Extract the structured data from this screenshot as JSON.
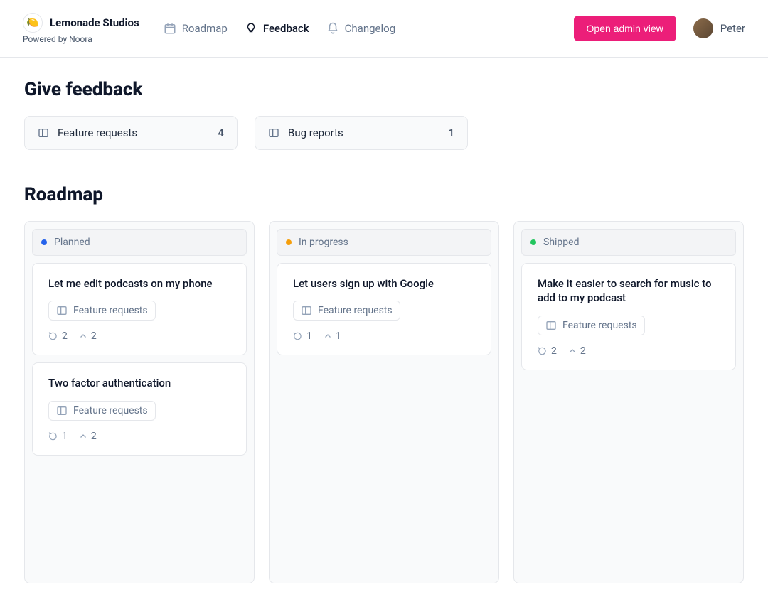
{
  "brand": {
    "name": "Lemonade Studios",
    "powered_by": "Powered by Noora",
    "logo_emoji": "🍋"
  },
  "nav": {
    "roadmap": "Roadmap",
    "feedback": "Feedback",
    "changelog": "Changelog"
  },
  "header": {
    "admin_button": "Open admin view",
    "user_name": "Peter"
  },
  "sections": {
    "give_feedback": "Give feedback",
    "roadmap": "Roadmap"
  },
  "feedback_boards": [
    {
      "label": "Feature requests",
      "count": "4"
    },
    {
      "label": "Bug reports",
      "count": "1"
    }
  ],
  "columns": [
    {
      "title": "Planned",
      "dot": "blue",
      "cards": [
        {
          "title": "Let me edit podcasts on my phone",
          "tag": "Feature requests",
          "comments": "2",
          "votes": "2"
        },
        {
          "title": "Two factor authentication",
          "tag": "Feature requests",
          "comments": "1",
          "votes": "2"
        }
      ]
    },
    {
      "title": "In progress",
      "dot": "amber",
      "cards": [
        {
          "title": "Let users sign up with Google",
          "tag": "Feature requests",
          "comments": "1",
          "votes": "1"
        }
      ]
    },
    {
      "title": "Shipped",
      "dot": "green",
      "cards": [
        {
          "title": "Make it easier to search for music to add to my podcast",
          "tag": "Feature requests",
          "comments": "2",
          "votes": "2"
        }
      ]
    }
  ]
}
